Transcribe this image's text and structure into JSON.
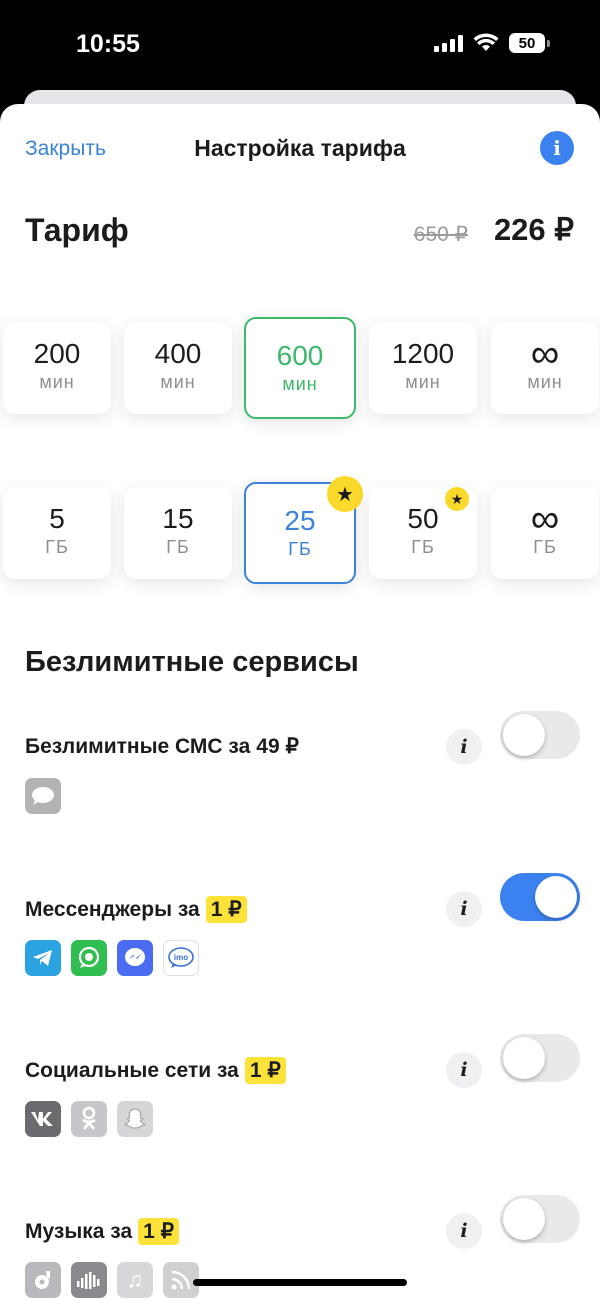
{
  "status_bar": {
    "time": "10:55",
    "battery": "50"
  },
  "nav": {
    "close": "Закрыть",
    "title": "Настройка тарифа"
  },
  "tariff": {
    "label": "Тариф",
    "old_price": "650 ₽",
    "new_price": "226 ₽"
  },
  "minutes": {
    "options": [
      {
        "value": "200",
        "unit": "мин"
      },
      {
        "value": "400",
        "unit": "мин"
      },
      {
        "value": "600",
        "unit": "мин",
        "selected": true
      },
      {
        "value": "1200",
        "unit": "мин"
      },
      {
        "value": "∞",
        "unit": "мин"
      }
    ]
  },
  "data": {
    "options": [
      {
        "value": "5",
        "unit": "ГБ"
      },
      {
        "value": "15",
        "unit": "ГБ"
      },
      {
        "value": "25",
        "unit": "ГБ",
        "selected": true,
        "star": true
      },
      {
        "value": "50",
        "unit": "ГБ",
        "star": true
      },
      {
        "value": "∞",
        "unit": "ГБ"
      }
    ]
  },
  "section_title": "Безлимитные сервисы",
  "services": [
    {
      "title": "Безлимитные СМС за",
      "price": "49 ₽",
      "enabled": false,
      "icons": [
        "sms-icon"
      ]
    },
    {
      "title": "Мессенджеры за",
      "price": "1 ₽",
      "enabled": true,
      "icons": [
        "telegram-icon",
        "whatsapp-icon",
        "messenger-icon"
      ],
      "icon_text": "imo"
    },
    {
      "title": "Социальные сети за",
      "price": "1 ₽",
      "enabled": false,
      "icons": [
        "vk-icon",
        "odnoklassniki-icon",
        "snapchat-icon"
      ]
    },
    {
      "title": "Музыка за",
      "price": "1 ₽",
      "enabled": false,
      "icons": [
        "music-app-icon",
        "podcast-icon",
        "music-note-icon",
        "radio-icon"
      ]
    }
  ],
  "colors": {
    "accent_blue": "#3b82d8",
    "selected_green": "#3cb96a",
    "price_highlight": "#fde23a"
  }
}
